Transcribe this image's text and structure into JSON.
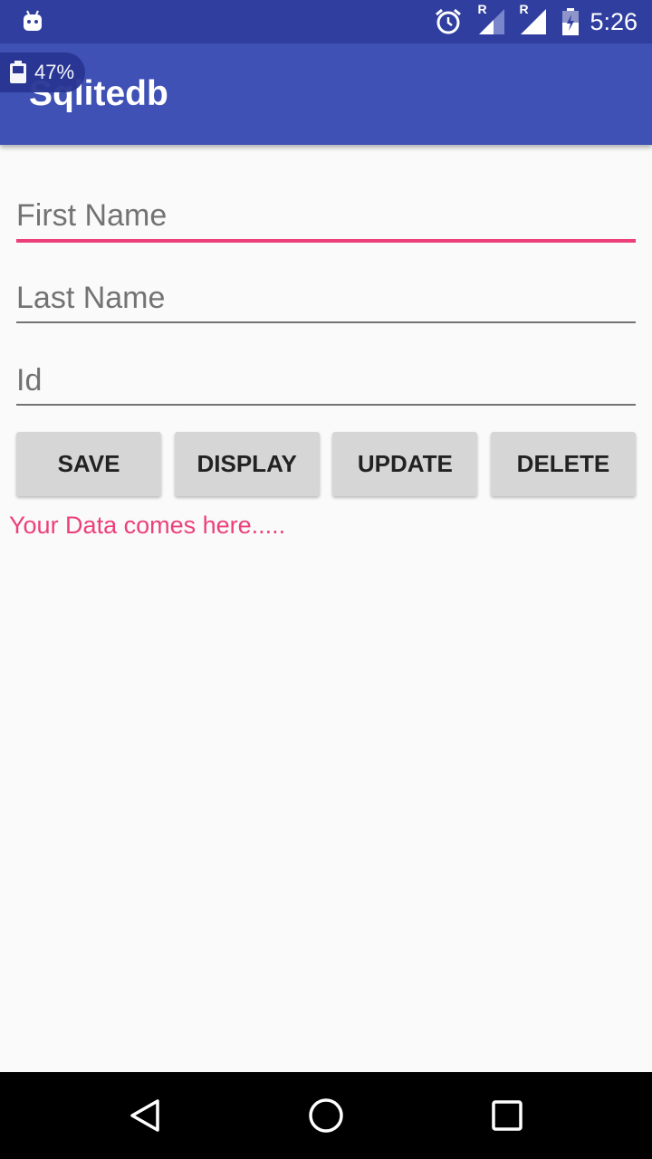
{
  "status_bar": {
    "time": "5:26",
    "signal_label_1": "R",
    "signal_label_2": "R"
  },
  "battery_overlay": {
    "percent": "47%"
  },
  "app_bar": {
    "title": "Sqlitedb"
  },
  "form": {
    "first_name": {
      "placeholder": "First Name",
      "value": ""
    },
    "last_name": {
      "placeholder": "Last Name",
      "value": ""
    },
    "id": {
      "placeholder": "Id",
      "value": ""
    }
  },
  "buttons": {
    "save": "SAVE",
    "display": "DISPLAY",
    "update": "UPDATE",
    "delete": "DELETE"
  },
  "output": {
    "text": "Your Data comes here....."
  },
  "colors": {
    "status_bar": "#303f9f",
    "app_bar": "#3f51b5",
    "accent": "#ec407a",
    "button": "#d6d6d6",
    "background": "#fafafa"
  },
  "icons": {
    "status_left": "android-notification-icon",
    "alarm": "alarm-clock-icon",
    "signal": "cell-signal-icon",
    "battery": "battery-icon",
    "nav_back": "back-triangle-icon",
    "nav_home": "home-circle-icon",
    "nav_recents": "recents-square-icon"
  }
}
